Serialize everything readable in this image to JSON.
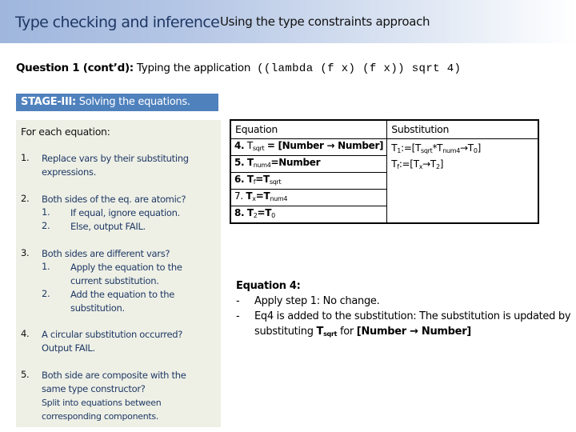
{
  "header": {
    "title": "Type checking and inference",
    "subtitle": "Using the type constraints approach"
  },
  "question": {
    "label": "Question 1 (cont’d):",
    "text": "Typing the application",
    "code": "((lambda (f x) (f x)) sqrt 4)"
  },
  "stage": {
    "label": "STAGE-III:",
    "text": "Solving the equations."
  },
  "steps": {
    "heading": "For each equation:",
    "items": [
      {
        "num": "1.",
        "text": "Replace vars by their substituting expressions."
      },
      {
        "num": "2.",
        "text": "Both sides of the eq. are atomic?",
        "subs": [
          {
            "num": "1.",
            "text": "If equal, ignore equation."
          },
          {
            "num": "2.",
            "text": "Else, output FAIL."
          }
        ]
      },
      {
        "num": "3.",
        "text": "Both sides are different vars?",
        "subs": [
          {
            "num": "1.",
            "text": "Apply the equation to the current substitution."
          },
          {
            "num": "2.",
            "text": "Add the equation to the substitution."
          }
        ]
      },
      {
        "num": "4.",
        "text": "A circular substitution occurred?",
        "extra": "Output FAIL."
      },
      {
        "num": "5.",
        "text": "Both side are composite with the same type constructor?",
        "extra": "Split into equations between corresponding components."
      }
    ]
  },
  "table": {
    "headers": [
      "Equation",
      "Substitution"
    ],
    "equations": [
      {
        "num": "4.",
        "lhs": "T",
        "lhs_sub": "sqrt",
        "rhs": "= [Number → Number]"
      },
      {
        "num": "5.",
        "lhs": "T",
        "lhs_sub": "num4",
        "rhs": "=Number"
      },
      {
        "num": "6.",
        "lhs": "T",
        "lhs_sub": "f",
        "rhs": "=T",
        "rhs_sub": "sqrt"
      },
      {
        "num": "7.",
        "lhs": "T",
        "lhs_sub": "x",
        "rhs": "=T",
        "rhs_sub": "num4"
      },
      {
        "num": "8.",
        "lhs": "T",
        "lhs_sub": "2",
        "rhs": "=T",
        "rhs_sub": "0"
      }
    ],
    "substitutions": [
      {
        "var": "T",
        "var_sub": "1",
        "value": ":=[T",
        "parts": [
          "sqrt",
          "*T",
          "num4",
          "→T",
          "0",
          "]"
        ]
      },
      {
        "var": "T",
        "var_sub": "f",
        "value": ":=[T",
        "parts": [
          "x",
          "→T",
          "2",
          "]"
        ]
      }
    ]
  },
  "note": {
    "heading": "Equation 4:",
    "items": [
      {
        "dash": "-",
        "text": "Apply step 1: No change."
      },
      {
        "dash": "-",
        "text_a": "Eq4 is added to the substitution: The substitution is updated by substituting ",
        "bold_var": "T",
        "bold_sub": "sqrt",
        "text_b": " for ",
        "bold_tail": "[Number → Number]"
      }
    ]
  }
}
